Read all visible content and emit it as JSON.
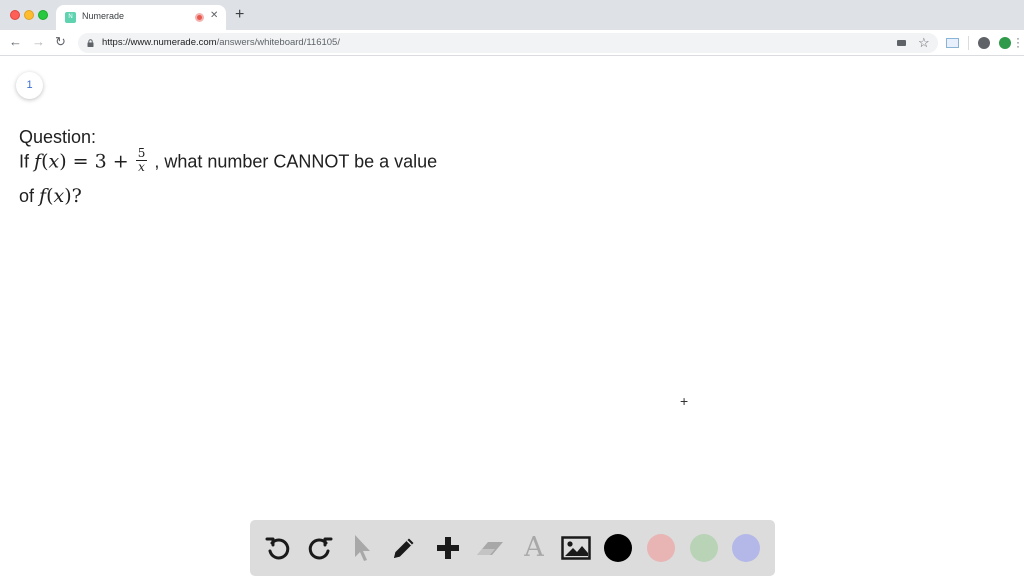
{
  "browser": {
    "tab_title": "Numerade",
    "favicon_text": "N",
    "new_tab_label": "+",
    "url_host": "https://www.numerade.com",
    "url_path": "/answers/whiteboard/116105/"
  },
  "page": {
    "badge": "1"
  },
  "question": {
    "heading": "Question:",
    "prefix": "If",
    "fn": "f",
    "var": "x",
    "equals_const": "= 3 +",
    "frac_num": "5",
    "frac_den": "x",
    "suffix": ", what number CANNOT be a value",
    "line2_prefix": "of",
    "line2_tail": "?"
  },
  "toolbar": {
    "tools": [
      "undo-icon",
      "redo-icon",
      "pointer-icon",
      "pencil-icon",
      "plus-icon",
      "eraser-icon",
      "text-icon",
      "image-icon"
    ],
    "colors": {
      "black": "#000000",
      "red": "#e8b4b4",
      "green": "#b9d3b6",
      "blue": "#b3b8e8"
    },
    "text_tool_glyph": "A"
  },
  "colors": {
    "toolbar_bg": "#dcdcdc",
    "active_icon": "#1a1a1a",
    "disabled_icon": "#a8a8a8"
  }
}
